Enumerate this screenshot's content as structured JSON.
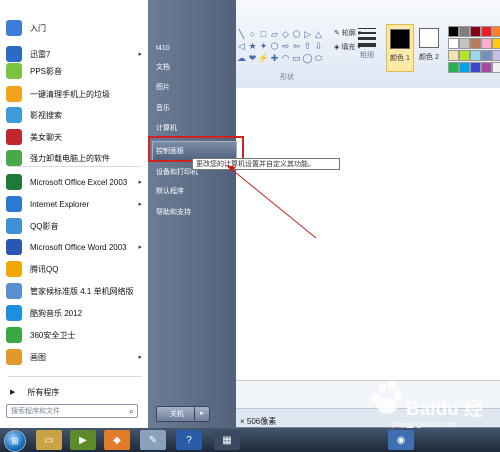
{
  "paint": {
    "ribbon": {
      "outline_label": "轮廓",
      "fill_label": "填充",
      "shapes_group": "形状",
      "thickness_label": "粗细",
      "color1_label": "颜色 1",
      "color2_label": "颜色 2",
      "color1_hex": "#000000",
      "color2_hex": "#ffffff",
      "shape_glyphs": [
        "╲",
        "○",
        "□",
        "▱",
        "◇",
        "⬠",
        "▷",
        "△",
        "◁",
        "★",
        "✦",
        "⬡",
        "⇨",
        "⇦",
        "⇧",
        "⇩",
        "☁",
        "❤",
        "⚡",
        "✚",
        "◠",
        "▭",
        "◯",
        "⬭"
      ],
      "palette": [
        "#000000",
        "#7f7f7f",
        "#880015",
        "#ed1c24",
        "#ff7f27",
        "#ffffff",
        "#c3c3c3",
        "#b97a57",
        "#ffaec9",
        "#ffc90e",
        "#efe4b0",
        "#b5e61d",
        "#99d9ea",
        "#7092be",
        "#c8bfe7",
        "#22b14c",
        "#00a2e8",
        "#3f48cc",
        "#a349a4",
        "#f0f0f0"
      ]
    },
    "status_text": "× 506像素"
  },
  "start_menu": {
    "pinned": [
      {
        "label": "入门",
        "icon": "getting-started-icon",
        "color": "#3b7dd8"
      },
      {
        "label": "迅雷7",
        "icon": "thunder-icon",
        "color": "#2a6bc4",
        "arrow": true
      },
      {
        "label": "PPS影音",
        "icon": "pps-icon",
        "color": "#7cc242"
      },
      {
        "label": "一键清理手机上的垃圾",
        "icon": "cleanup-icon",
        "color": "#f2a31b"
      },
      {
        "label": "影视搜索",
        "icon": "video-search-icon",
        "color": "#3e9ad9"
      },
      {
        "label": "美女聊天",
        "icon": "chat-icon",
        "color": "#c1272d"
      },
      {
        "label": "强力卸载电脑上的软件",
        "icon": "uninstall-icon",
        "color": "#4aa84a"
      }
    ],
    "recent": [
      {
        "label": "Microsoft Office Excel 2003",
        "icon": "excel-icon",
        "color": "#1f7a3a",
        "arrow": true
      },
      {
        "label": "Internet Explorer",
        "icon": "ie-icon",
        "color": "#2b79d1",
        "arrow": true
      },
      {
        "label": "QQ影音",
        "icon": "qq-player-icon",
        "color": "#3f91d6"
      },
      {
        "label": "Microsoft Office Word 2003",
        "icon": "word-icon",
        "color": "#2a56b6",
        "arrow": true
      },
      {
        "label": "腾讯QQ",
        "icon": "qq-icon",
        "color": "#f0a800"
      },
      {
        "label": "管家候标准版 4.1 单机网络版",
        "icon": "manager-icon",
        "color": "#5b8fd2"
      },
      {
        "label": "酷狗音乐 2012",
        "icon": "kugou-icon",
        "color": "#1d8fe0"
      },
      {
        "label": "360安全卫士",
        "icon": "360-icon",
        "color": "#3aa745"
      },
      {
        "label": "画图",
        "icon": "paint-icon",
        "color": "#e09a2b",
        "arrow": true
      }
    ],
    "all_programs": "所有程序",
    "search_placeholder": "搜索程序和文件",
    "right_items": [
      {
        "label": "t410",
        "name": "user-folder"
      },
      {
        "label": "文档",
        "name": "documents"
      },
      {
        "label": "图片",
        "name": "pictures"
      },
      {
        "label": "音乐",
        "name": "music"
      },
      {
        "label": "计算机",
        "name": "computer"
      },
      {
        "label": "控制面板",
        "name": "control-panel"
      },
      {
        "label": "设备和打印机",
        "name": "devices-printers"
      },
      {
        "label": "默认程序",
        "name": "default-programs"
      },
      {
        "label": "帮助和支持",
        "name": "help-support"
      }
    ],
    "tooltip": "更改您的计算机设置并自定义其功能。",
    "shutdown": "关机"
  },
  "watermark": {
    "text": "Baidu 经验",
    "sub": "jingyan.baidu.com"
  }
}
